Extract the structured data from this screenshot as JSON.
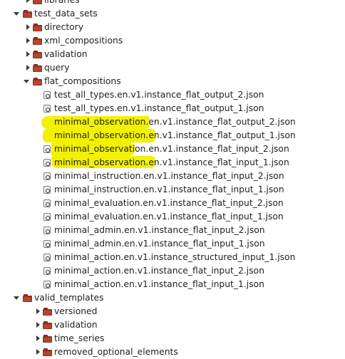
{
  "tree": {
    "libraries": "libraries",
    "test_data_sets": {
      "label": "test_data_sets",
      "children": [
        "directory",
        "xml_compositions",
        "validation",
        "query"
      ],
      "flat_compositions": {
        "label": "flat_compositions",
        "files": [
          "test_all_types.en.v1.instance_flat_output_2.json",
          "test_all_types.en.v1.instance_flat_output_1.json",
          "minimal_observation.en.v1.instance_flat_output_2.json",
          "minimal_observation.en.v1.instance_flat_output_1.json",
          "minimal_observation.en.v1.instance_flat_input_2.json",
          "minimal_observation.en.v1.instance_flat_input_1.json",
          "minimal_instruction.en.v1.instance_flat_input_2.json",
          "minimal_instruction.en.v1.instance_flat_input_1.json",
          "minimal_evaluation.en.v1.instance_flat_input_2.json",
          "minimal_evaluation.en.v1.instance_flat_input_1.json",
          "minimal_admin.en.v1.instance_flat_input_2.json",
          "minimal_admin.en.v1.instance_flat_input_1.json",
          "minimal_action.en.v1.instance_structured_input_1.json",
          "minimal_action.en.v1.instance_flat_input_2.json",
          "minimal_action.en.v1.instance_flat_input_1.json"
        ]
      }
    },
    "valid_templates": {
      "label": "valid_templates",
      "children": [
        "versioned",
        "validation",
        "time_series",
        "removed_optional_elements"
      ]
    }
  },
  "colors": {
    "highlight": "#f2f200",
    "folder": "#b8442d",
    "text": "#222222"
  }
}
